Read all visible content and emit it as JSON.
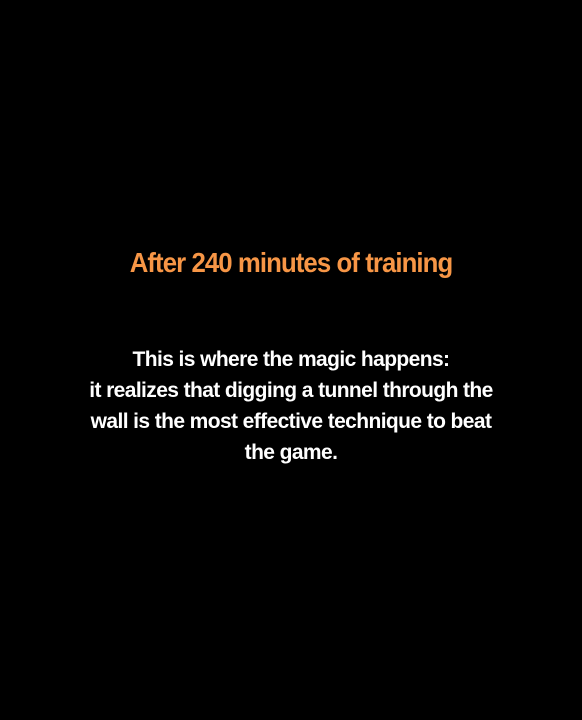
{
  "colors": {
    "background": "#000000",
    "title": "#F79646",
    "body": "#FFFFFF"
  },
  "slide": {
    "title": "After 240 minutes of training",
    "body_lines": [
      "This is where the magic happens:",
      "it realizes that digging a tunnel through the",
      "wall is the most effective technique to beat",
      "the game."
    ]
  }
}
